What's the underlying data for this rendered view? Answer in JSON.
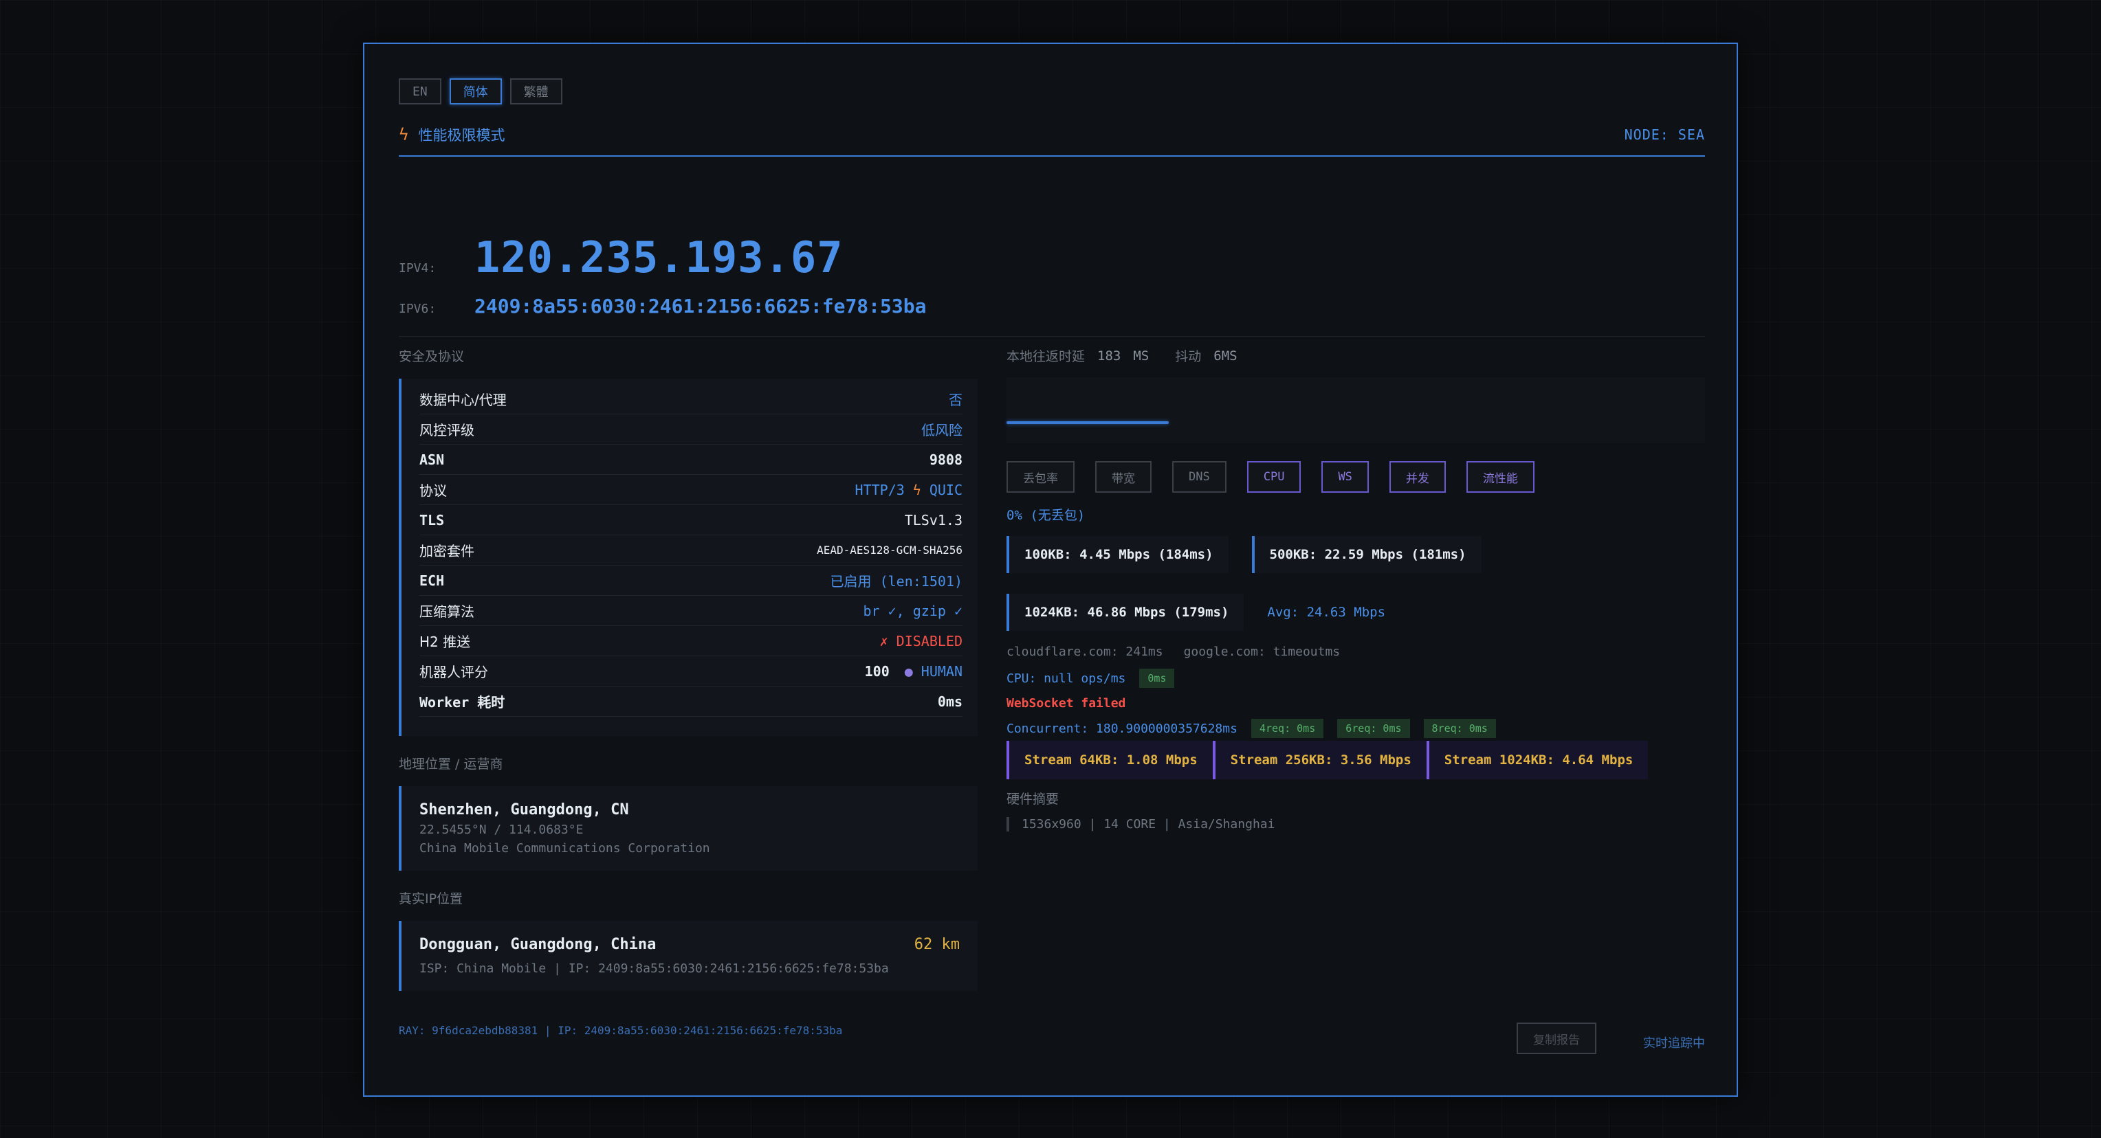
{
  "lang": [
    "EN",
    "简体",
    "繁體"
  ],
  "mode": {
    "label": "性能极限模式",
    "node": "NODE: SEA"
  },
  "ip": {
    "v4_label": "IPV4:",
    "v4": "120.235.193.67",
    "v6_label": "IPV6:",
    "v6": "2409:8a55:6030:2461:2156:6625:fe78:53ba"
  },
  "security": {
    "title": "安全及协议",
    "rows": [
      {
        "k": "数据中心/代理",
        "v": "否"
      },
      {
        "k": "风控评级",
        "v": "低风险"
      },
      {
        "k": "ASN",
        "v": "9808"
      },
      {
        "k": "协议",
        "v": "HTTP/3",
        "v2": "QUIC"
      },
      {
        "k": "TLS",
        "v": "TLSv1.3"
      },
      {
        "k": "加密套件",
        "v": "AEAD-AES128-GCM-SHA256"
      },
      {
        "k": "ECH",
        "v": "已启用 (len:1501)"
      },
      {
        "k": "压缩算法",
        "v": "br ✓, gzip ✓"
      },
      {
        "k": "H2 推送",
        "v": "✗ DISABLED"
      },
      {
        "k": "机器人评分",
        "v": "100",
        "v2": "HUMAN"
      },
      {
        "k": "Worker 耗时",
        "v": "0ms"
      }
    ]
  },
  "geo": {
    "title": "地理位置 / 运营商",
    "city": "Shenzhen, Guangdong, CN",
    "coords": "22.5455°N / 114.0683°E",
    "org": "China Mobile Communications Corporation"
  },
  "real": {
    "title": "真实IP位置",
    "city": "Dongguan, Guangdong, China",
    "distance": "62 km",
    "isp": "ISP: China Mobile | IP: 2409:8a55:6030:2461:2156:6625:fe78:53ba"
  },
  "rtt": {
    "label": "本地往返时延",
    "value": "183",
    "unit": "MS",
    "jitter_label": "抖动",
    "jitter": "6MS"
  },
  "tabs": [
    "丢包率",
    "带宽",
    "DNS",
    "CPU",
    "WS",
    "并发",
    "流性能"
  ],
  "loss": "0% (无丢包)",
  "bandwidth": {
    "b100": "100KB: 4.45 Mbps (184ms)",
    "b500": "500KB: 22.59 Mbps (181ms)",
    "b1024": "1024KB: 46.86 Mbps (179ms)",
    "avg": "Avg: 24.63 Mbps"
  },
  "dns": {
    "cf": "cloudflare.com: 241ms",
    "google": "google.com: timeoutms"
  },
  "cpu": {
    "text": "CPU: null ops/ms",
    "chip": "0ms"
  },
  "ws": "WebSocket failed",
  "concurrent": {
    "text": "Concurrent: 180.9000000357628ms",
    "chips": [
      "4req: 0ms",
      "6req: 0ms",
      "8req: 0ms"
    ]
  },
  "streams": [
    "Stream 64KB: 1.08 Mbps",
    "Stream 256KB: 3.56 Mbps",
    "Stream 1024KB: 4.64 Mbps"
  ],
  "hardware": {
    "title": "硬件摘要",
    "text": "1536x960 | 14 CORE | Asia/Shanghai"
  },
  "footer": {
    "ray": "RAY: 9f6dca2ebdb88381 | IP: 2409:8a55:6030:2461:2156:6625:fe78:53ba",
    "copy": "复制报告",
    "tracking": "实时追踪中"
  }
}
